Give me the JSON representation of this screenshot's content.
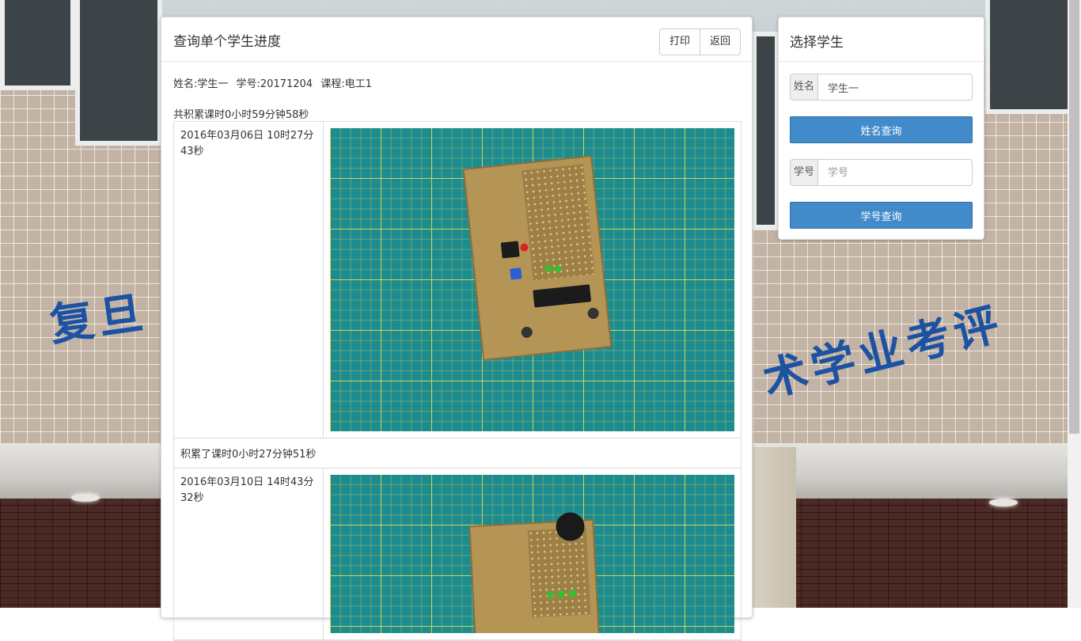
{
  "main_panel": {
    "title": "查询单个学生进度",
    "buttons": {
      "print": "打印",
      "back": "返回"
    },
    "student": {
      "name": "姓名:学生一",
      "id": "学号:20171204",
      "course": "课程:电工1"
    },
    "total_hours": "共积累课时0小时59分钟58秒",
    "records": [
      {
        "date": "2016年03月06日 10时27分43秒",
        "summary": "积累了课时0小时27分钟51秒"
      },
      {
        "date": "2016年03月10日 14时43分32秒"
      }
    ]
  },
  "side_panel": {
    "title": "选择学生",
    "name_search": {
      "label": "姓名",
      "value": "学生一",
      "button": "姓名查询"
    },
    "id_search": {
      "label": "学号",
      "placeholder": "学号",
      "button": "学号查询"
    }
  },
  "background": {
    "sign_left": "复旦",
    "sign_right": "术学业考评"
  },
  "colors": {
    "primary": "#428bca",
    "sign_blue": "#1d52a3",
    "mat_teal": "#1d8c8e"
  }
}
